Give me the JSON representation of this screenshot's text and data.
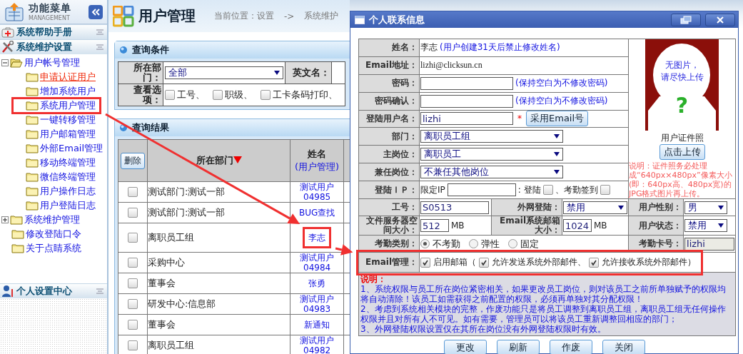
{
  "sidebar": {
    "title": "功能菜单",
    "subtitle": "MANAGEMENT",
    "sections": [
      {
        "label": "系统帮助手册",
        "kind": "help"
      },
      {
        "label": "系统维护设置",
        "kind": "settings"
      }
    ],
    "tree": [
      {
        "label": "用户帐号管理",
        "expanded": true,
        "selected": false,
        "children": [
          {
            "label": "申请认证用户",
            "selected": true
          },
          {
            "label": "增加系统用户",
            "selected": false
          },
          {
            "label": "系统用户管理",
            "selected": false,
            "annotated": true
          },
          {
            "label": "一键转移管理",
            "selected": false
          },
          {
            "label": "用户邮箱管理",
            "selected": false
          },
          {
            "label": "外部Email管理",
            "selected": false
          },
          {
            "label": "移动终端管理",
            "selected": false
          },
          {
            "label": "微信终端管理",
            "selected": false
          },
          {
            "label": "用户操作日志",
            "selected": false
          },
          {
            "label": "用户登陆日志",
            "selected": false
          }
        ]
      },
      {
        "label": "系统维护管理",
        "expanded": false,
        "selected": false
      },
      {
        "label": "修改登陆口令",
        "selected": false
      },
      {
        "label": "关于点睛系统",
        "selected": false
      }
    ],
    "bottom_section": {
      "label": "个人设置中心",
      "kind": "personal"
    }
  },
  "main": {
    "title": "用户管理",
    "breadcrumb": [
      "当前位置：设置",
      "->",
      "系统维护"
    ],
    "query_panel": {
      "title": "查询条件",
      "department_label": "所在部门：",
      "department_value": "全部",
      "english_name_label": "英文名：",
      "options_label": "查看选项：",
      "options": [
        {
          "label": "工号、",
          "checked": false
        },
        {
          "label": "职级、",
          "checked": false
        },
        {
          "label": "工卡条码打印、",
          "checked": false
        }
      ]
    },
    "results_panel": {
      "title": "查询结果",
      "delete_button": "删除",
      "columns": [
        {
          "label": "所在部门",
          "sorted": true
        },
        {
          "label": "姓名",
          "link": "(用户管理)"
        }
      ],
      "rows": [
        {
          "department": "测试部门:测试一部",
          "name": "测试用户",
          "code": "04985",
          "checked": false
        },
        {
          "department": "测试部门:测试一部",
          "name": "BUG查找",
          "checked": false
        },
        {
          "department": "离职员工组",
          "name": "李志",
          "checked": false,
          "annotated": true
        },
        {
          "department": "采购中心",
          "name": "测试用户",
          "code": "04984",
          "checked": false
        },
        {
          "department": "董事会",
          "name": "张勇",
          "checked": false
        },
        {
          "department": "研发中心:信息部",
          "name": "测试用户",
          "code": "04983",
          "checked": false
        },
        {
          "department": "董事会",
          "name": "新通知",
          "checked": false
        },
        {
          "department": "离职员工组",
          "name": "测试用户",
          "code": "04982",
          "checked": false
        }
      ]
    }
  },
  "dialog": {
    "title": "个人联系信息",
    "name": {
      "label": "姓名：",
      "value": "李志",
      "note": "(用户创建31天后禁止修改姓名)"
    },
    "email": {
      "label": "Email地址：",
      "value": "lizhi@clicksun.cn"
    },
    "password": {
      "label": "密码：",
      "note": "(保持空白为不修改密码)"
    },
    "password_confirm": {
      "label": "密码确认：",
      "note": "(保持空白为不修改密码)"
    },
    "login_name": {
      "label": "登陆用户名：",
      "value": "lizhi",
      "required_mark": "*",
      "button": "采用Email号"
    },
    "department": {
      "label": "部门：",
      "value": "离职员工组"
    },
    "main_post": {
      "label": "主岗位：",
      "value": "离职员工"
    },
    "side_post": {
      "label": "兼任岗位：",
      "value": "不兼任其他岗位"
    },
    "login_ip": {
      "label": "登陆ＩＰ：",
      "prefix": "限定IP",
      "checks": [
        {
          "label": ": 登陆",
          "checked": false
        },
        {
          "label": "、考勤签到",
          "checked": false
        }
      ]
    },
    "employee_no": {
      "label": "工号：",
      "value": "S0513"
    },
    "external_login": {
      "label": "外网登陆：",
      "value": "禁用"
    },
    "gender": {
      "label": "用户性别：",
      "value": "男"
    },
    "file_quota": {
      "label": "文件服务器空间大小：",
      "value": "512",
      "unit": "MB"
    },
    "mail_quota": {
      "label": "Email系统邮箱大小：",
      "value": "1024",
      "unit": "MB"
    },
    "status": {
      "label": "用户状态：",
      "value": "禁用"
    },
    "attendance": {
      "label": "考勤类别：",
      "options": [
        {
          "label": "不考勤",
          "selected": true
        },
        {
          "label": "弹性",
          "selected": false
        },
        {
          "label": "固定",
          "selected": false
        }
      ]
    },
    "attendance_card": {
      "label": "考勤卡号：",
      "value": "lizhi",
      "disabled": true
    },
    "email_mgmt": {
      "label": "Email管理：",
      "annotated": true,
      "options": [
        {
          "label": "启用邮箱（",
          "checked": true
        },
        {
          "label": "允许发送系统外部邮件、",
          "checked": true
        },
        {
          "label": "允许接收系统外部邮件）",
          "checked": true
        }
      ]
    },
    "notes": {
      "title": "说明：",
      "items": [
        "1、系统权限与员工所在岗位紧密相关，如果更改员工岗位，则对该员工之前所单独赋予的权限均将自动清除！该员工如需获得之前配置的权限，必须再单独对其分配权限！",
        "2、考虑到系统相关模块的完整，作废功能只是将员工调整到离职员工组，离职员工组无任何操作权限并且对所有人不可见。如有需要，管理员可以将该员工重新调整回相应的部门；",
        "3、外网登陆权限设置仅在其所在岗位没有外网登陆权限时有效。"
      ]
    },
    "photo": {
      "placeholder": [
        "无图片，",
        "请尽快上传"
      ],
      "mark": "?",
      "caption": "用户证件照",
      "button": "点击上传",
      "note": "说明：证件照务必处理成“640px×480px”像素大小(即：640px高、480px宽)的JPG格式图片再上传。"
    },
    "buttons": [
      "更改",
      "刷新",
      "作废",
      "关闭"
    ]
  }
}
